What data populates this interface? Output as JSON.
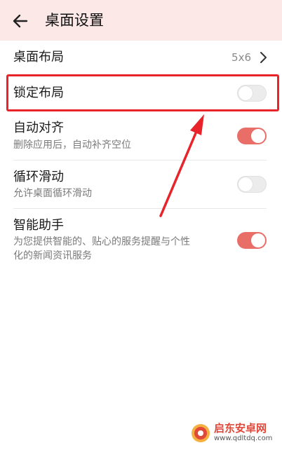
{
  "header": {
    "title": "桌面设置",
    "back_icon": "arrow-left-icon"
  },
  "settings": [
    {
      "title": "桌面布局",
      "value": "5x6"
    },
    {
      "title": "锁定布局",
      "toggle": "off"
    },
    {
      "title": "自动对齐",
      "subtitle": "删除应用后，自动补齐空位",
      "toggle": "on"
    },
    {
      "title": "循环滑动",
      "subtitle": "允许桌面循环滑动",
      "toggle": "off"
    },
    {
      "title": "智能助手",
      "subtitle_line1": "为您提供智能的、贴心的服务提醒与个性",
      "subtitle_line2": "化的新闻资讯服务",
      "toggle": "on"
    }
  ],
  "colors": {
    "header_bg": "#fce9e7",
    "toggle_on": "#e86e67",
    "highlight": "#e8232a"
  },
  "watermark": {
    "name": "启东安卓网",
    "url": "www.qdltdq.com"
  }
}
